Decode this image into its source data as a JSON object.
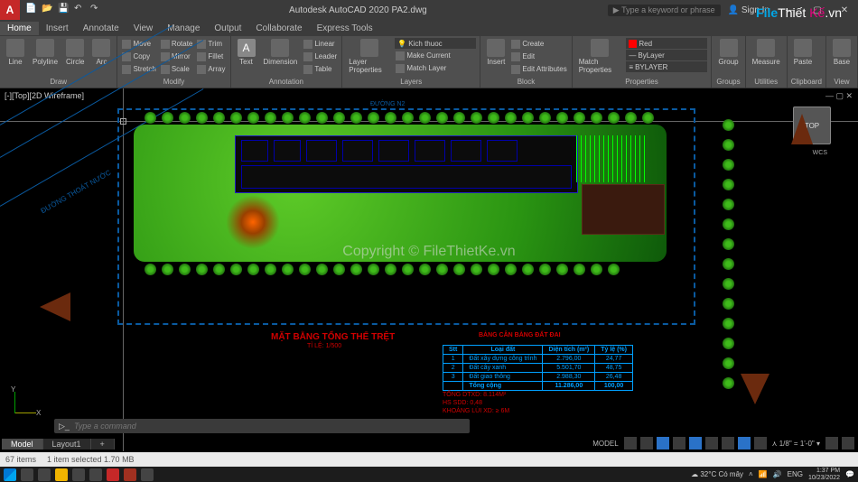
{
  "titlebar": {
    "app_letter": "A",
    "title": "Autodesk AutoCAD 2020   PA2.dwg",
    "search_placeholder": "Type a keyword or phrase",
    "signin": "Sign In"
  },
  "menutabs": [
    "Home",
    "Insert",
    "Annotate",
    "View",
    "Manage",
    "Output",
    "Collaborate",
    "Express Tools"
  ],
  "ribbon": {
    "draw": {
      "title": "Draw",
      "line": "Line",
      "polyline": "Polyline",
      "circle": "Circle",
      "arc": "Arc"
    },
    "modify": {
      "title": "Modify",
      "r1": [
        "Move",
        "Rotate",
        "Trim"
      ],
      "r2": [
        "Copy",
        "Mirror",
        "Fillet"
      ],
      "r3": [
        "Stretch",
        "Scale",
        "Array"
      ]
    },
    "annotation": {
      "title": "Annotation",
      "text": "Text",
      "dim": "Dimension",
      "linear": "Linear",
      "leader": "Leader",
      "table": "Table"
    },
    "layers": {
      "title": "Layers",
      "btn": "Layer\nProperties",
      "current": "Kich thuoc",
      "make": "Make Current",
      "match": "Match Layer"
    },
    "block": {
      "title": "Block",
      "insert": "Insert",
      "create": "Create",
      "edit": "Edit",
      "attr": "Edit Attributes"
    },
    "properties": {
      "title": "Properties",
      "match": "Match\nProperties",
      "color": "Red",
      "lt": "ByLayer",
      "lw": "BYLAYER"
    },
    "groups": {
      "title": "Groups",
      "btn": "Group"
    },
    "utilities": {
      "title": "Utilities",
      "btn": "Measure"
    },
    "clipboard": {
      "title": "Clipboard",
      "btn": "Paste"
    },
    "view": {
      "title": "View",
      "btn": "Base"
    }
  },
  "viewport": {
    "label": "[-][Top][2D Wireframe]",
    "cube": "TOP",
    "wcs": "WCS",
    "x": "X",
    "y": "Y"
  },
  "drawing": {
    "title": "MẶT BẰNG TỔNG THỂ TRỆT",
    "scale": "TỈ LỆ: 1/500",
    "table_title": "BẢNG CÂN BẰNG ĐẤT ĐAI",
    "table_headers": [
      "Stt",
      "Loại đất",
      "Diện tích (m²)",
      "Tỷ lệ (%)"
    ],
    "table_rows": [
      [
        "1",
        "Đất xây dựng công trình",
        "2.796,00",
        "24,77"
      ],
      [
        "2",
        "Đất cây xanh",
        "5.501,70",
        "48,75"
      ],
      [
        "3",
        "Đất giao thông",
        "2.988,30",
        "26,48"
      ],
      [
        "",
        "Tổng cộng",
        "11.286,00",
        "100,00"
      ]
    ],
    "notes": [
      "TỔNG DTXD:    8.114M²",
      "HS SDD:          0,48",
      "KHOẢNG LÙI XD: ≥ 6M"
    ],
    "road_label": "ĐƯỜNG THOÁT NƯỚC",
    "border1": "ĐƯỜNG N2"
  },
  "cmdline": {
    "placeholder": "Type a command"
  },
  "layouttabs": [
    "Model",
    "Layout1"
  ],
  "statusbar": {
    "model": "MODEL",
    "scale": "1/8\" = 1'-0\""
  },
  "explorer": {
    "items": "67 items",
    "selected": "1 item selected  1.70 MB"
  },
  "taskbar": {
    "weather": "32°C  Có mây",
    "lang": "ENG",
    "time": "1:37 PM",
    "date": "10/23/2022"
  },
  "overlay": {
    "copyright": "Copyright © FileThietKe.vn"
  }
}
